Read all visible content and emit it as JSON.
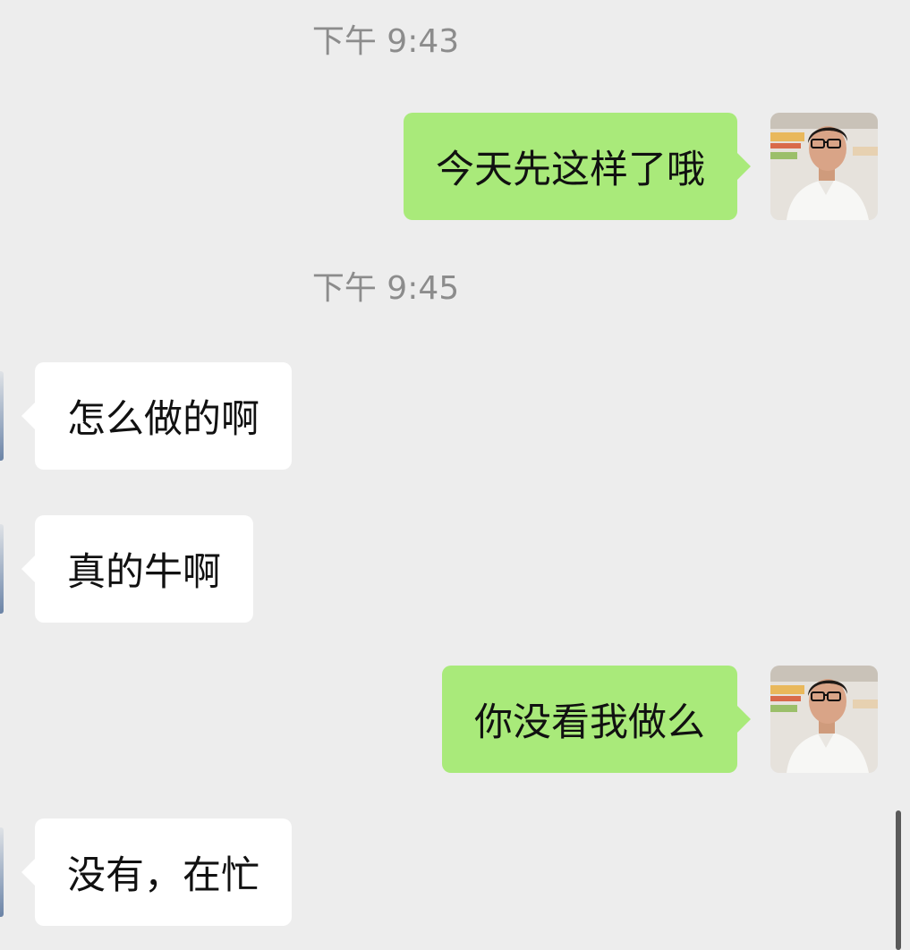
{
  "messages": [
    {
      "type": "timestamp",
      "text": "下午 9:43"
    },
    {
      "type": "outgoing",
      "text": "今天先这样了哦"
    },
    {
      "type": "timestamp",
      "text": "下午 9:45"
    },
    {
      "type": "incoming",
      "text": "怎么做的啊"
    },
    {
      "type": "incoming",
      "text": "真的牛啊"
    },
    {
      "type": "outgoing",
      "text": "你没看我做么"
    },
    {
      "type": "incoming",
      "text": "没有，在忙"
    }
  ],
  "colors": {
    "background": "#ededed",
    "outgoing_bubble": "#a9ea7a",
    "incoming_bubble": "#ffffff",
    "timestamp_text": "#8c8c8c"
  },
  "icons": {
    "own_avatar": "avatar-photo-man-glasses",
    "peer_avatar": "avatar-partial"
  }
}
